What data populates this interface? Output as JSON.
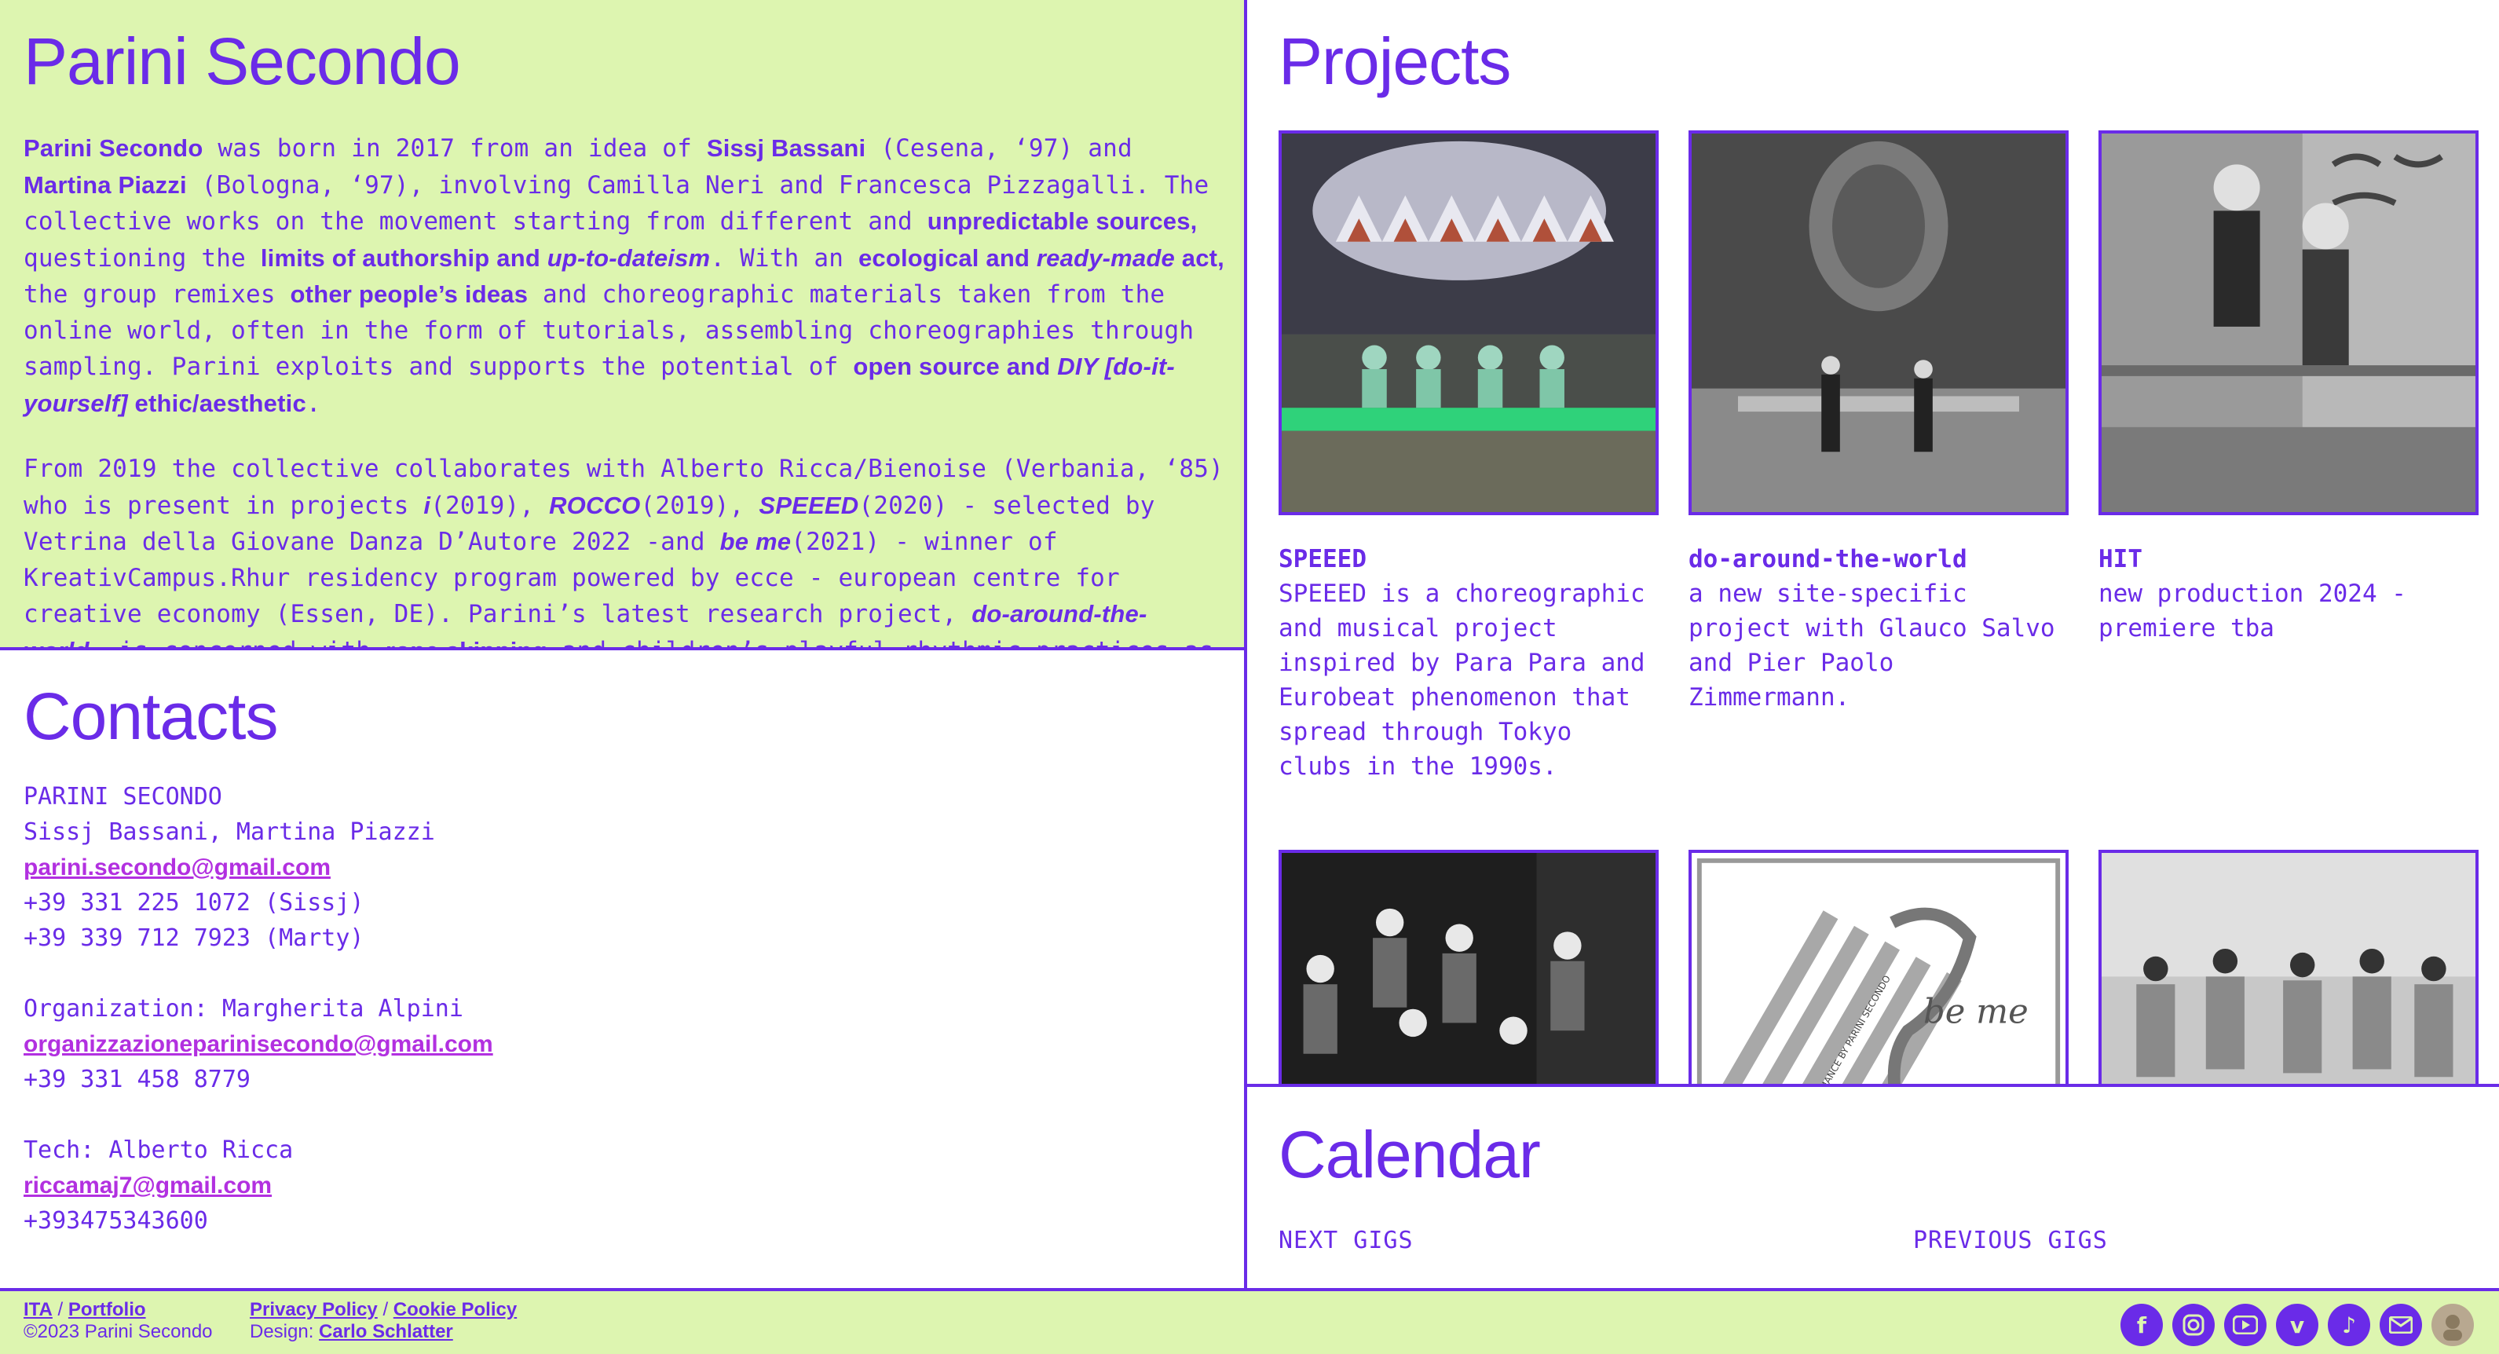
{
  "about": {
    "title": "Parini Secondo",
    "p1": [
      {
        "t": "Parini Secondo",
        "s": "b"
      },
      {
        "t": " was born in 2017 from an idea of ",
        "s": ""
      },
      {
        "t": "Sissj Bassani",
        "s": "b"
      },
      {
        "t": " (Cesena, ‘97) and ",
        "s": ""
      },
      {
        "t": "Martina Piazzi",
        "s": "b"
      },
      {
        "t": " (Bologna, ‘97), involving Camilla Neri and Francesca Pizzagalli. The collective works on the movement starting from different and ",
        "s": ""
      },
      {
        "t": "unpredictable sources,",
        "s": "b"
      },
      {
        "t": " questioning the ",
        "s": ""
      },
      {
        "t": "limits of authorship and ",
        "s": "b"
      },
      {
        "t": "up-to-dateism",
        "s": "i"
      },
      {
        "t": ". With an ",
        "s": ""
      },
      {
        "t": "ecological and ",
        "s": "b"
      },
      {
        "t": "ready-made",
        "s": "i"
      },
      {
        "t": " act,",
        "s": "b"
      },
      {
        "t": " the group remixes ",
        "s": ""
      },
      {
        "t": "other people’s ideas",
        "s": "b"
      },
      {
        "t": " and choreographic materials taken from the online world, often in the form of tutorials, assembling choreographies through sampling. Parini exploits and supports the potential of ",
        "s": ""
      },
      {
        "t": "open source and ",
        "s": "b"
      },
      {
        "t": "DIY [do-it-yourself]",
        "s": "i"
      },
      {
        "t": " ethic/aesthetic",
        "s": "b"
      },
      {
        "t": ".",
        "s": ""
      }
    ],
    "p2": [
      {
        "t": "From 2019 the collective collaborates with Alberto Ricca/Bienoise (Verbania, ‘85) who is present in projects ",
        "s": ""
      },
      {
        "t": "i",
        "s": "i"
      },
      {
        "t": "(2019), ",
        "s": ""
      },
      {
        "t": "ROCCO",
        "s": "i"
      },
      {
        "t": "(2019), ",
        "s": ""
      },
      {
        "t": "SPEEED",
        "s": "i"
      },
      {
        "t": "(2020) - selected by Vetrina della Giovane Danza D’Autore 2022 -and ",
        "s": ""
      },
      {
        "t": "be me",
        "s": "i"
      },
      {
        "t": "(2021) - winner of KreativCampus.Rhur residency program powered by ecce - european centre for creative economy (Essen, DE). Parini’s latest research project, ",
        "s": ""
      },
      {
        "t": "do-around-the-world",
        "s": "i"
      },
      {
        "t": ", is concerned with ",
        "s": ""
      },
      {
        "t": "rope skipping",
        "s": "b"
      },
      {
        "t": " and children’s playful rhythmic practices as cultural",
        "s": ""
      }
    ]
  },
  "contacts": {
    "title": "Contacts",
    "name": "PARINI SECONDO",
    "people": "Sissj Bassani, Martina Piazzi",
    "email": "parini.secondo@gmail.com",
    "phone_sissj": "+39 331 225 1072 (Sissj)",
    "phone_marty": "+39 339 712 7923 (Marty)",
    "org_label": "Organization: Margherita Alpini",
    "org_email": "organizzazioneparinisecondo@gmail.com",
    "org_phone": "+39 331 458 8779",
    "tech_label": "Tech: Alberto Ricca",
    "tech_email": "riccamaj7@gmail.com",
    "tech_phone": "+393475343600"
  },
  "projects": {
    "title": "Projects",
    "items": [
      {
        "title": "SPEEED",
        "desc": "SPEEED is a choreographic and musical project inspired by Para Para and Eurobeat phenomenon that spread through Tokyo clubs in the 1990s."
      },
      {
        "title": "do-around-the-world",
        "desc": "a new site-specific project with Glauco Salvo and Pier Paolo Zimmermann."
      },
      {
        "title": "HIT",
        "desc": "new production 2024 - premiere tba"
      }
    ],
    "be_me_text": "be me",
    "be_me_poster_text": "A DANCE PERFORMANCE BY PARINI SECONDO"
  },
  "calendar": {
    "title": "Calendar",
    "next": "NEXT GIGS",
    "previous": "PREVIOUS GIGS"
  },
  "footer": {
    "lang": "ITA",
    "sep1": " / ",
    "portfolio": "Portfolio",
    "copyright": "©2023 Parini Secondo",
    "privacy": "Privacy Policy",
    "sep2": " / ",
    "cookie": "Cookie Policy",
    "design_label": "Design: ",
    "designer": "Carlo Schlatter"
  },
  "social_icons": [
    "facebook-icon",
    "instagram-icon",
    "youtube-icon",
    "vimeo-icon",
    "tiktok-icon",
    "mail-icon",
    "avatar-icon"
  ],
  "colors": {
    "accent": "#6a2be8",
    "link": "#b230e0",
    "lime": "#ddf5b0"
  }
}
